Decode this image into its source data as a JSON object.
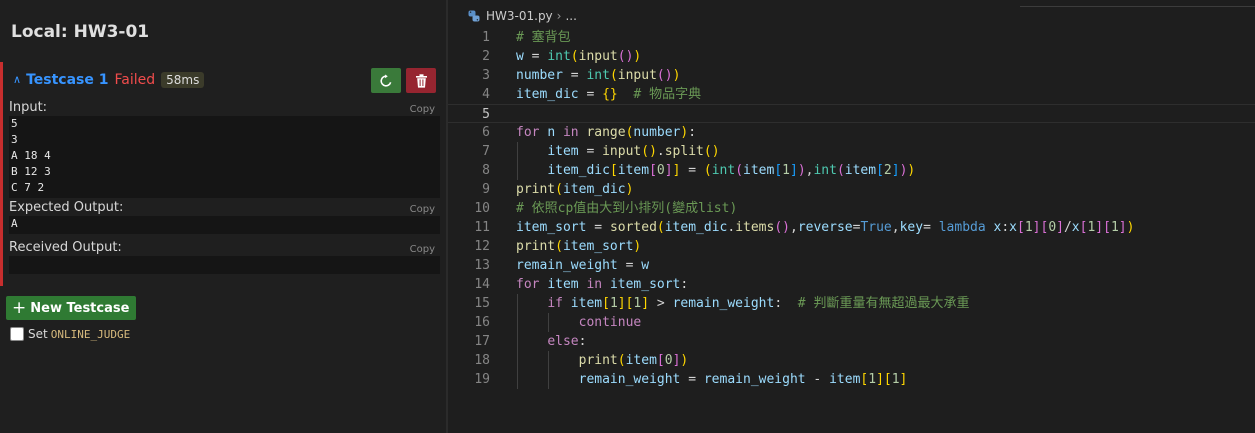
{
  "panel": {
    "title": "Local: HW3-01",
    "testcase": {
      "name": "Testcase 1",
      "status": "Failed",
      "time": "58ms"
    },
    "input_label": "Input:",
    "input_value": "5\n3\nA 18 4\nB 12 3\nC 7 2",
    "expected_label": "Expected Output:",
    "expected_value": "A",
    "received_label": "Received Output:",
    "received_value": "",
    "copy_label": "Copy",
    "new_testcase_label": "New Testcase",
    "set_label": "Set",
    "online_judge_label": "ONLINE_JUDGE"
  },
  "editor": {
    "breadcrumb_file": "HW3-01.py",
    "breadcrumb_more": "...",
    "active_line": 5,
    "lines": [
      [
        [
          "cm",
          "# 塞背包"
        ]
      ],
      [
        [
          "var",
          "w"
        ],
        [
          "op",
          " = "
        ],
        [
          "ty",
          "int"
        ],
        [
          "b1",
          "("
        ],
        [
          "fn",
          "input"
        ],
        [
          "b2",
          "()"
        ],
        [
          "b1",
          ")"
        ]
      ],
      [
        [
          "var",
          "number"
        ],
        [
          "op",
          " = "
        ],
        [
          "ty",
          "int"
        ],
        [
          "b1",
          "("
        ],
        [
          "fn",
          "input"
        ],
        [
          "b2",
          "()"
        ],
        [
          "b1",
          ")"
        ]
      ],
      [
        [
          "var",
          "item_dic"
        ],
        [
          "op",
          " = "
        ],
        [
          "b1",
          "{}"
        ],
        [
          "op",
          "  "
        ],
        [
          "cm",
          "# 物品字典"
        ]
      ],
      [],
      [
        [
          "kw",
          "for"
        ],
        [
          "op",
          " "
        ],
        [
          "var",
          "n"
        ],
        [
          "op",
          " "
        ],
        [
          "kw",
          "in"
        ],
        [
          "op",
          " "
        ],
        [
          "fn",
          "range"
        ],
        [
          "b1",
          "("
        ],
        [
          "var",
          "number"
        ],
        [
          "b1",
          ")"
        ],
        [
          "op",
          ":"
        ]
      ],
      [
        [
          "op",
          "    "
        ],
        [
          "var",
          "item"
        ],
        [
          "op",
          " = "
        ],
        [
          "fn",
          "input"
        ],
        [
          "b1",
          "()"
        ],
        [
          "op",
          "."
        ],
        [
          "fn",
          "split"
        ],
        [
          "b1",
          "()"
        ]
      ],
      [
        [
          "op",
          "    "
        ],
        [
          "var",
          "item_dic"
        ],
        [
          "b1",
          "["
        ],
        [
          "var",
          "item"
        ],
        [
          "b2",
          "["
        ],
        [
          "num",
          "0"
        ],
        [
          "b2",
          "]"
        ],
        [
          "b1",
          "]"
        ],
        [
          "op",
          " = "
        ],
        [
          "b1",
          "("
        ],
        [
          "ty",
          "int"
        ],
        [
          "b2",
          "("
        ],
        [
          "var",
          "item"
        ],
        [
          "b3",
          "["
        ],
        [
          "num",
          "1"
        ],
        [
          "b3",
          "]"
        ],
        [
          "b2",
          ")"
        ],
        [
          "op",
          ","
        ],
        [
          "ty",
          "int"
        ],
        [
          "b2",
          "("
        ],
        [
          "var",
          "item"
        ],
        [
          "b3",
          "["
        ],
        [
          "num",
          "2"
        ],
        [
          "b3",
          "]"
        ],
        [
          "b2",
          ")"
        ],
        [
          "b1",
          ")"
        ]
      ],
      [
        [
          "fn",
          "print"
        ],
        [
          "b1",
          "("
        ],
        [
          "var",
          "item_dic"
        ],
        [
          "b1",
          ")"
        ]
      ],
      [
        [
          "cm",
          "# 依照cp值由大到小排列(變成list)"
        ]
      ],
      [
        [
          "var",
          "item_sort"
        ],
        [
          "op",
          " = "
        ],
        [
          "fn",
          "sorted"
        ],
        [
          "b1",
          "("
        ],
        [
          "var",
          "item_dic"
        ],
        [
          "op",
          "."
        ],
        [
          "fn",
          "items"
        ],
        [
          "b2",
          "()"
        ],
        [
          "op",
          ","
        ],
        [
          "var",
          "reverse"
        ],
        [
          "op",
          "="
        ],
        [
          "bl",
          "True"
        ],
        [
          "op",
          ","
        ],
        [
          "var",
          "key"
        ],
        [
          "op",
          "= "
        ],
        [
          "bl",
          "lambda"
        ],
        [
          "op",
          " "
        ],
        [
          "var",
          "x"
        ],
        [
          "op",
          ":"
        ],
        [
          "var",
          "x"
        ],
        [
          "b2",
          "["
        ],
        [
          "num",
          "1"
        ],
        [
          "b2",
          "]"
        ],
        [
          "b2",
          "["
        ],
        [
          "num",
          "0"
        ],
        [
          "b2",
          "]"
        ],
        [
          "op",
          "/"
        ],
        [
          "var",
          "x"
        ],
        [
          "b2",
          "["
        ],
        [
          "num",
          "1"
        ],
        [
          "b2",
          "]"
        ],
        [
          "b2",
          "["
        ],
        [
          "num",
          "1"
        ],
        [
          "b2",
          "]"
        ],
        [
          "b1",
          ")"
        ]
      ],
      [
        [
          "fn",
          "print"
        ],
        [
          "b1",
          "("
        ],
        [
          "var",
          "item_sort"
        ],
        [
          "b1",
          ")"
        ]
      ],
      [
        [
          "var",
          "remain_weight"
        ],
        [
          "op",
          " = "
        ],
        [
          "var",
          "w"
        ]
      ],
      [
        [
          "kw",
          "for"
        ],
        [
          "op",
          " "
        ],
        [
          "var",
          "item"
        ],
        [
          "op",
          " "
        ],
        [
          "kw",
          "in"
        ],
        [
          "op",
          " "
        ],
        [
          "var",
          "item_sort"
        ],
        [
          "op",
          ":"
        ]
      ],
      [
        [
          "op",
          "    "
        ],
        [
          "kw",
          "if"
        ],
        [
          "op",
          " "
        ],
        [
          "var",
          "item"
        ],
        [
          "b1",
          "["
        ],
        [
          "num",
          "1"
        ],
        [
          "b1",
          "]"
        ],
        [
          "b1",
          "["
        ],
        [
          "num",
          "1"
        ],
        [
          "b1",
          "]"
        ],
        [
          "op",
          " > "
        ],
        [
          "var",
          "remain_weight"
        ],
        [
          "op",
          ":  "
        ],
        [
          "cm",
          "# 判斷重量有無超過最大承重"
        ]
      ],
      [
        [
          "op",
          "        "
        ],
        [
          "kw",
          "continue"
        ]
      ],
      [
        [
          "op",
          "    "
        ],
        [
          "kw",
          "else"
        ],
        [
          "op",
          ":"
        ]
      ],
      [
        [
          "op",
          "        "
        ],
        [
          "fn",
          "print"
        ],
        [
          "b1",
          "("
        ],
        [
          "var",
          "item"
        ],
        [
          "b2",
          "["
        ],
        [
          "num",
          "0"
        ],
        [
          "b2",
          "]"
        ],
        [
          "b1",
          ")"
        ]
      ],
      [
        [
          "op",
          "        "
        ],
        [
          "var",
          "remain_weight"
        ],
        [
          "op",
          " = "
        ],
        [
          "var",
          "remain_weight"
        ],
        [
          "op",
          " - "
        ],
        [
          "var",
          "item"
        ],
        [
          "b1",
          "["
        ],
        [
          "num",
          "1"
        ],
        [
          "b1",
          "]"
        ],
        [
          "b1",
          "["
        ],
        [
          "num",
          "1"
        ],
        [
          "b1",
          "]"
        ]
      ]
    ]
  },
  "colors": {
    "accent": "#3794ff",
    "failed": "#f14c4c",
    "success_button": "#3a7a3a",
    "delete_button": "#962530",
    "new_testcase": "#2f7a33"
  }
}
